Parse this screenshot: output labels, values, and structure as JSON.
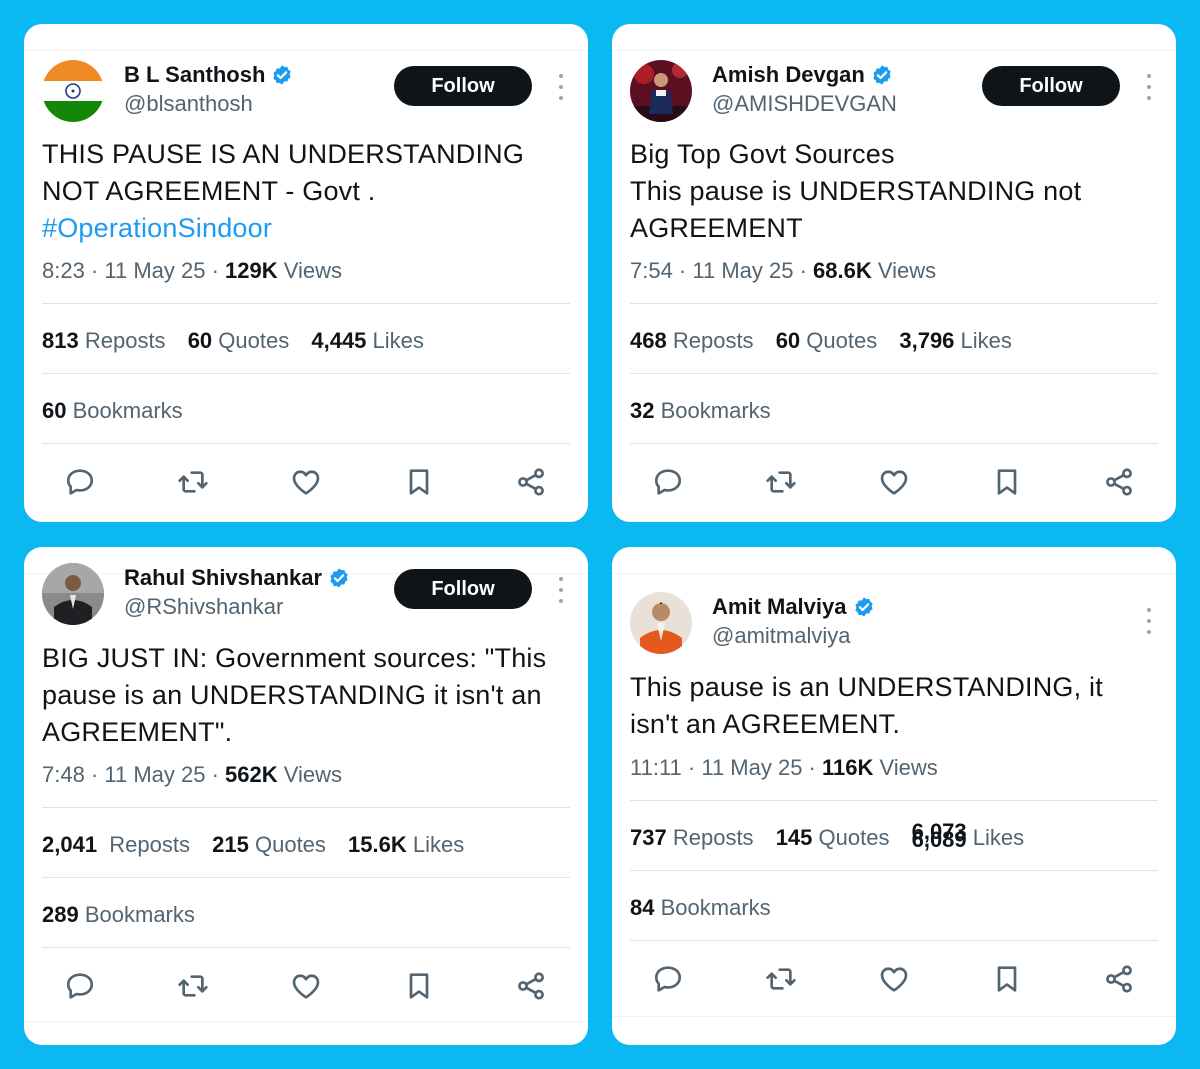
{
  "colors": {
    "background": "#0bb8f2",
    "verified": "#1d9bf0",
    "follow_bg": "#0f1419",
    "hashtag": "#1d9bf0"
  },
  "tweets": [
    {
      "name": "B L Santhosh",
      "handle": "@blsanthosh",
      "follow_label": "Follow",
      "avatar_icon": "india-flag-avatar",
      "text_lines": [
        "THIS PAUSE IS AN UNDERSTANDING",
        "NOT AGREEMENT - Govt ."
      ],
      "hashtag": "#OperationSindoor",
      "time": "8:23 · 11 May 25 · ",
      "views_count": "129K",
      "views_label": " Views",
      "reposts": "813",
      "reposts_label": "Reposts",
      "quotes": "60",
      "quotes_label": "Quotes",
      "likes": "4,445",
      "likes_label": "Likes",
      "bookmarks": "60",
      "bookmarks_label": "Bookmarks"
    },
    {
      "name": "Amish Devgan",
      "handle": "@AMISHDEVGAN",
      "follow_label": "Follow",
      "avatar_icon": "person-on-stage-avatar",
      "text_lines": [
        "Big Top Govt Sources",
        "This pause is UNDERSTANDING not",
        "AGREEMENT"
      ],
      "time": "7:54 · 11 May 25 · ",
      "views_count": "68.6K",
      "views_label": " Views",
      "reposts": "468",
      "reposts_label": "Reposts",
      "quotes": "60",
      "quotes_label": "Quotes",
      "likes": "3,796",
      "likes_label": "Likes",
      "bookmarks": "32",
      "bookmarks_label": "Bookmarks"
    },
    {
      "name": "Rahul Shivshankar",
      "handle": "@RShivshankar",
      "follow_label": "Follow",
      "avatar_icon": "person-in-suit-avatar",
      "text_lines": [
        "BIG JUST IN: Government sources: \"This",
        "pause is an UNDERSTANDING it isn't an",
        "AGREEMENT\"."
      ],
      "time": "7:48 · 11 May 25 · ",
      "views_count": "562K",
      "views_label": " Views",
      "reposts": "2,041",
      "reposts_label": "Reposts",
      "quotes": "215",
      "quotes_label": "Quotes",
      "likes": "15.6K",
      "likes_label": "Likes",
      "bookmarks": "289",
      "bookmarks_label": "Bookmarks"
    },
    {
      "name": "Amit Malviya",
      "handle": "@amitmalviya",
      "avatar_icon": "person-orange-jacket-avatar",
      "text_lines": [
        "This pause is an UNDERSTANDING, it",
        "isn't an AGREEMENT."
      ],
      "time": "11:11 · 11 May 25 · ",
      "views_count": "116K",
      "views_label": " Views",
      "reposts": "737",
      "reposts_label": "Reposts",
      "quotes": "145",
      "quotes_label": "Quotes",
      "likes": "6,073",
      "likes_alt": "6,089",
      "likes_label": "Likes",
      "bookmarks": "84",
      "bookmarks_label": "Bookmarks"
    }
  ],
  "action_icons": [
    "reply-icon",
    "repost-icon",
    "like-icon",
    "bookmark-icon",
    "share-icon"
  ]
}
